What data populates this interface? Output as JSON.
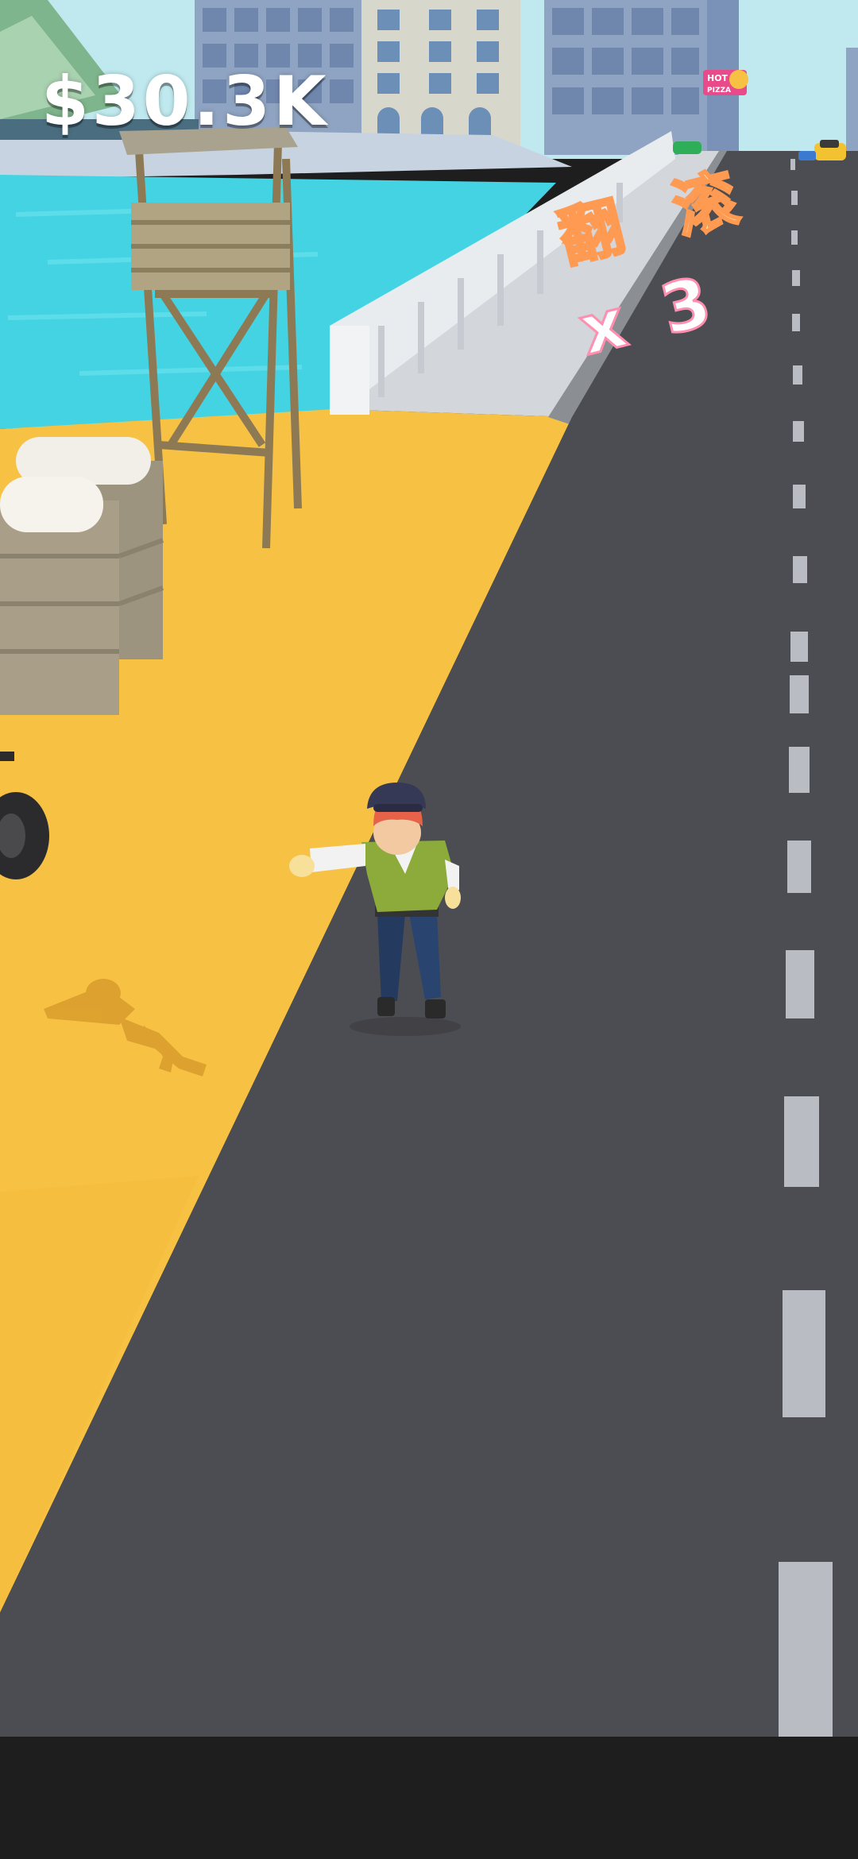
{
  "hud": {
    "money": "$30.3K"
  },
  "combo": {
    "label": "翻 滚",
    "multiplier": "x 3"
  },
  "billboard": {
    "text_line1": "HOT",
    "text_line2": "PIZZA"
  },
  "colors": {
    "sky": "#bfe9ee",
    "water": "#44d3e3",
    "sand": "#f7c244",
    "road": "#4b4d52",
    "lane_marking": "#b9bcc2",
    "bottom_bar": "#1e1e1f"
  },
  "icons": [
    "player-character",
    "shadow-figure",
    "lifeguard-tower",
    "crate-stack",
    "bridge-railing",
    "city-buildings",
    "car-yellow",
    "car-green",
    "tire"
  ]
}
